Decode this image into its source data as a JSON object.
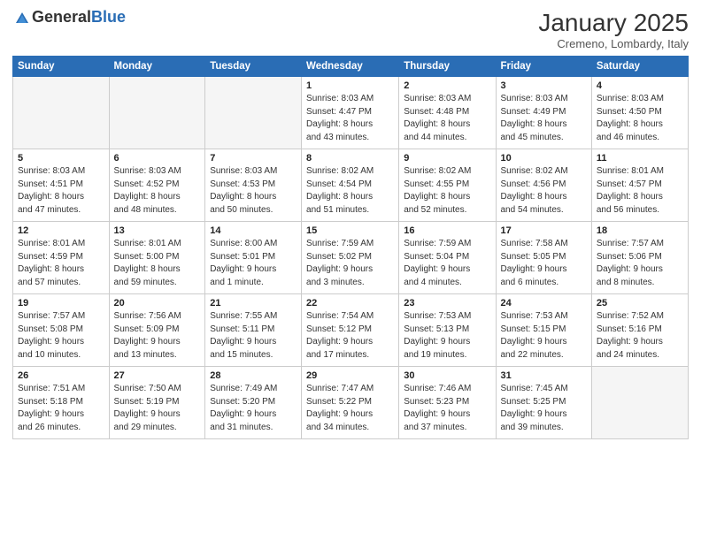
{
  "logo": {
    "general": "General",
    "blue": "Blue"
  },
  "title": "January 2025",
  "location": "Cremeno, Lombardy, Italy",
  "weekdays": [
    "Sunday",
    "Monday",
    "Tuesday",
    "Wednesday",
    "Thursday",
    "Friday",
    "Saturday"
  ],
  "weeks": [
    [
      {
        "day": "",
        "info": ""
      },
      {
        "day": "",
        "info": ""
      },
      {
        "day": "",
        "info": ""
      },
      {
        "day": "1",
        "info": "Sunrise: 8:03 AM\nSunset: 4:47 PM\nDaylight: 8 hours\nand 43 minutes."
      },
      {
        "day": "2",
        "info": "Sunrise: 8:03 AM\nSunset: 4:48 PM\nDaylight: 8 hours\nand 44 minutes."
      },
      {
        "day": "3",
        "info": "Sunrise: 8:03 AM\nSunset: 4:49 PM\nDaylight: 8 hours\nand 45 minutes."
      },
      {
        "day": "4",
        "info": "Sunrise: 8:03 AM\nSunset: 4:50 PM\nDaylight: 8 hours\nand 46 minutes."
      }
    ],
    [
      {
        "day": "5",
        "info": "Sunrise: 8:03 AM\nSunset: 4:51 PM\nDaylight: 8 hours\nand 47 minutes."
      },
      {
        "day": "6",
        "info": "Sunrise: 8:03 AM\nSunset: 4:52 PM\nDaylight: 8 hours\nand 48 minutes."
      },
      {
        "day": "7",
        "info": "Sunrise: 8:03 AM\nSunset: 4:53 PM\nDaylight: 8 hours\nand 50 minutes."
      },
      {
        "day": "8",
        "info": "Sunrise: 8:02 AM\nSunset: 4:54 PM\nDaylight: 8 hours\nand 51 minutes."
      },
      {
        "day": "9",
        "info": "Sunrise: 8:02 AM\nSunset: 4:55 PM\nDaylight: 8 hours\nand 52 minutes."
      },
      {
        "day": "10",
        "info": "Sunrise: 8:02 AM\nSunset: 4:56 PM\nDaylight: 8 hours\nand 54 minutes."
      },
      {
        "day": "11",
        "info": "Sunrise: 8:01 AM\nSunset: 4:57 PM\nDaylight: 8 hours\nand 56 minutes."
      }
    ],
    [
      {
        "day": "12",
        "info": "Sunrise: 8:01 AM\nSunset: 4:59 PM\nDaylight: 8 hours\nand 57 minutes."
      },
      {
        "day": "13",
        "info": "Sunrise: 8:01 AM\nSunset: 5:00 PM\nDaylight: 8 hours\nand 59 minutes."
      },
      {
        "day": "14",
        "info": "Sunrise: 8:00 AM\nSunset: 5:01 PM\nDaylight: 9 hours\nand 1 minute."
      },
      {
        "day": "15",
        "info": "Sunrise: 7:59 AM\nSunset: 5:02 PM\nDaylight: 9 hours\nand 3 minutes."
      },
      {
        "day": "16",
        "info": "Sunrise: 7:59 AM\nSunset: 5:04 PM\nDaylight: 9 hours\nand 4 minutes."
      },
      {
        "day": "17",
        "info": "Sunrise: 7:58 AM\nSunset: 5:05 PM\nDaylight: 9 hours\nand 6 minutes."
      },
      {
        "day": "18",
        "info": "Sunrise: 7:57 AM\nSunset: 5:06 PM\nDaylight: 9 hours\nand 8 minutes."
      }
    ],
    [
      {
        "day": "19",
        "info": "Sunrise: 7:57 AM\nSunset: 5:08 PM\nDaylight: 9 hours\nand 10 minutes."
      },
      {
        "day": "20",
        "info": "Sunrise: 7:56 AM\nSunset: 5:09 PM\nDaylight: 9 hours\nand 13 minutes."
      },
      {
        "day": "21",
        "info": "Sunrise: 7:55 AM\nSunset: 5:11 PM\nDaylight: 9 hours\nand 15 minutes."
      },
      {
        "day": "22",
        "info": "Sunrise: 7:54 AM\nSunset: 5:12 PM\nDaylight: 9 hours\nand 17 minutes."
      },
      {
        "day": "23",
        "info": "Sunrise: 7:53 AM\nSunset: 5:13 PM\nDaylight: 9 hours\nand 19 minutes."
      },
      {
        "day": "24",
        "info": "Sunrise: 7:53 AM\nSunset: 5:15 PM\nDaylight: 9 hours\nand 22 minutes."
      },
      {
        "day": "25",
        "info": "Sunrise: 7:52 AM\nSunset: 5:16 PM\nDaylight: 9 hours\nand 24 minutes."
      }
    ],
    [
      {
        "day": "26",
        "info": "Sunrise: 7:51 AM\nSunset: 5:18 PM\nDaylight: 9 hours\nand 26 minutes."
      },
      {
        "day": "27",
        "info": "Sunrise: 7:50 AM\nSunset: 5:19 PM\nDaylight: 9 hours\nand 29 minutes."
      },
      {
        "day": "28",
        "info": "Sunrise: 7:49 AM\nSunset: 5:20 PM\nDaylight: 9 hours\nand 31 minutes."
      },
      {
        "day": "29",
        "info": "Sunrise: 7:47 AM\nSunset: 5:22 PM\nDaylight: 9 hours\nand 34 minutes."
      },
      {
        "day": "30",
        "info": "Sunrise: 7:46 AM\nSunset: 5:23 PM\nDaylight: 9 hours\nand 37 minutes."
      },
      {
        "day": "31",
        "info": "Sunrise: 7:45 AM\nSunset: 5:25 PM\nDaylight: 9 hours\nand 39 minutes."
      },
      {
        "day": "",
        "info": ""
      }
    ]
  ]
}
